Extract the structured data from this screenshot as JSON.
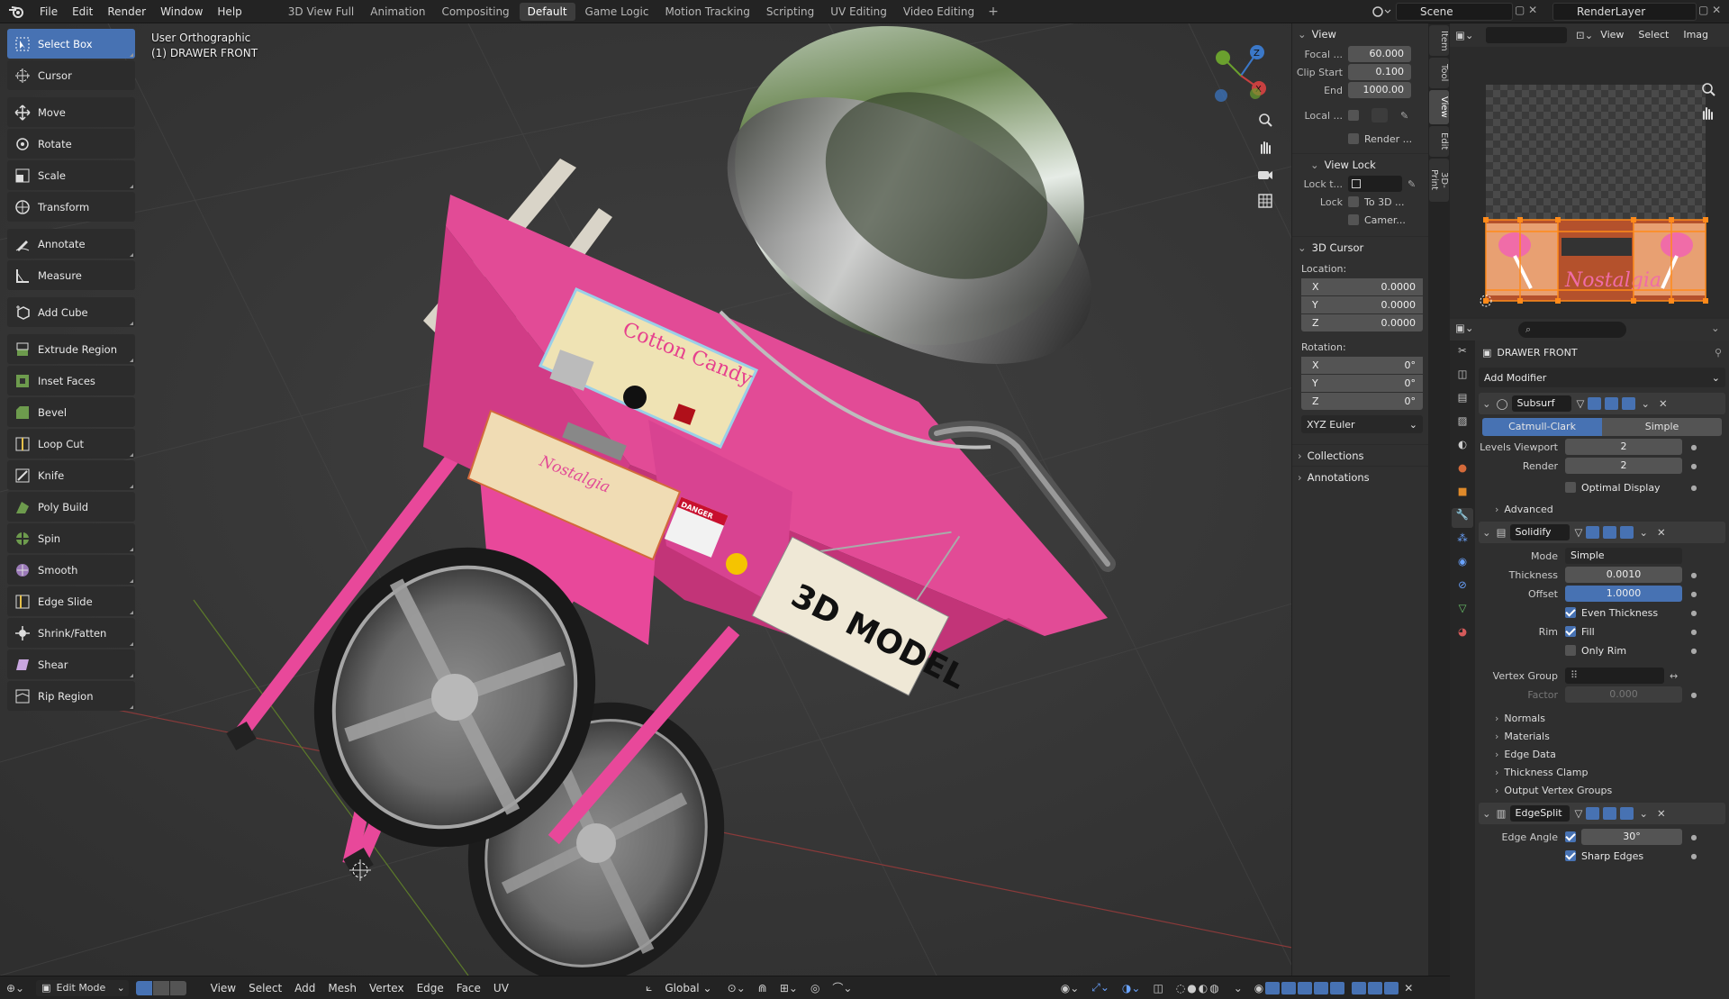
{
  "topbar": {
    "menus": [
      "File",
      "Edit",
      "Render",
      "Window",
      "Help"
    ],
    "workspaces": [
      "3D View Full",
      "Animation",
      "Compositing",
      "Default",
      "Game Logic",
      "Motion Tracking",
      "Scripting",
      "UV Editing",
      "Video Editing"
    ],
    "active_workspace": "Default",
    "scene": "Scene",
    "render_layer": "RenderLayer"
  },
  "viewport": {
    "view_name": "User Orthographic",
    "object_name": "(1) DRAWER FRONT",
    "model": {
      "sign_text": "3D MODEL",
      "panel_brand": "Cotton Candy",
      "drawer_brand": "Nostalgia",
      "warning_label": "DANGER"
    }
  },
  "toolbar": {
    "tools": [
      "Select Box",
      "Cursor",
      "Move",
      "Rotate",
      "Scale",
      "Transform",
      "Annotate",
      "Measure",
      "Add Cube",
      "Extrude Region",
      "Inset Faces",
      "Bevel",
      "Loop Cut",
      "Knife",
      "Poly Build",
      "Spin",
      "Smooth",
      "Edge Slide",
      "Shrink/Fatten",
      "Shear",
      "Rip Region"
    ],
    "active": "Select Box"
  },
  "npanel": {
    "view_title": "View",
    "focal_label": "Focal ...",
    "focal": "60.000",
    "clip_start_label": "Clip Start",
    "clip_start": "0.100",
    "end_label": "End",
    "clip_end": "1000.00",
    "local_label": "Local ...",
    "render_label": "Render ...",
    "view_lock_title": "View Lock",
    "lock_to_label": "Lock t...",
    "lock_label": "Lock",
    "to_3d_label": "To 3D ...",
    "camera_label": "Camer...",
    "cursor_title": "3D Cursor",
    "location_label": "Location:",
    "location": {
      "x": "0.0000",
      "y": "0.0000",
      "z": "0.0000"
    },
    "rotation_label": "Rotation:",
    "rotation": {
      "x": "0°",
      "y": "0°",
      "z": "0°"
    },
    "rotation_mode": "XYZ Euler",
    "collections_label": "Collections",
    "annotations_label": "Annotations",
    "tabs": [
      "Item",
      "Tool",
      "View",
      "Edit",
      "3D-Print"
    ]
  },
  "uv_editor": {
    "menus": [
      "View",
      "Select",
      "Imag"
    ],
    "texture_text": "Nostalgia"
  },
  "properties": {
    "object": "DRAWER FRONT",
    "add_modifier": "Add Modifier",
    "subsurf": {
      "name": "Subsurf",
      "catmull": "Catmull-Clark",
      "simple": "Simple",
      "levels_viewport_label": "Levels Viewport",
      "levels_viewport": "2",
      "render_label": "Render",
      "render": "2",
      "optimal_display": "Optimal Display",
      "advanced": "Advanced"
    },
    "solidify": {
      "name": "Solidify",
      "mode_label": "Mode",
      "mode": "Simple",
      "thickness_label": "Thickness",
      "thickness": "0.0010",
      "offset_label": "Offset",
      "offset": "1.0000",
      "even_thickness": "Even Thickness",
      "rim_label": "Rim",
      "fill": "Fill",
      "only_rim": "Only Rim",
      "vertex_group_label": "Vertex Group",
      "factor_label": "Factor",
      "factor": "0.000",
      "subpanels": [
        "Normals",
        "Materials",
        "Edge Data",
        "Thickness Clamp",
        "Output Vertex Groups"
      ]
    },
    "edgesplit": {
      "name": "EdgeSplit",
      "edge_angle_label": "Edge Angle",
      "edge_angle": "30°",
      "sharp_edges": "Sharp Edges"
    }
  },
  "bottombar": {
    "mode": "Edit Mode",
    "menus": [
      "View",
      "Select",
      "Add",
      "Mesh",
      "Vertex",
      "Edge",
      "Face",
      "UV"
    ],
    "orientation": "Global"
  },
  "colors": {
    "accent": "#4772b3",
    "cart_pink": "#e8489a",
    "panel_bg": "#303030"
  }
}
